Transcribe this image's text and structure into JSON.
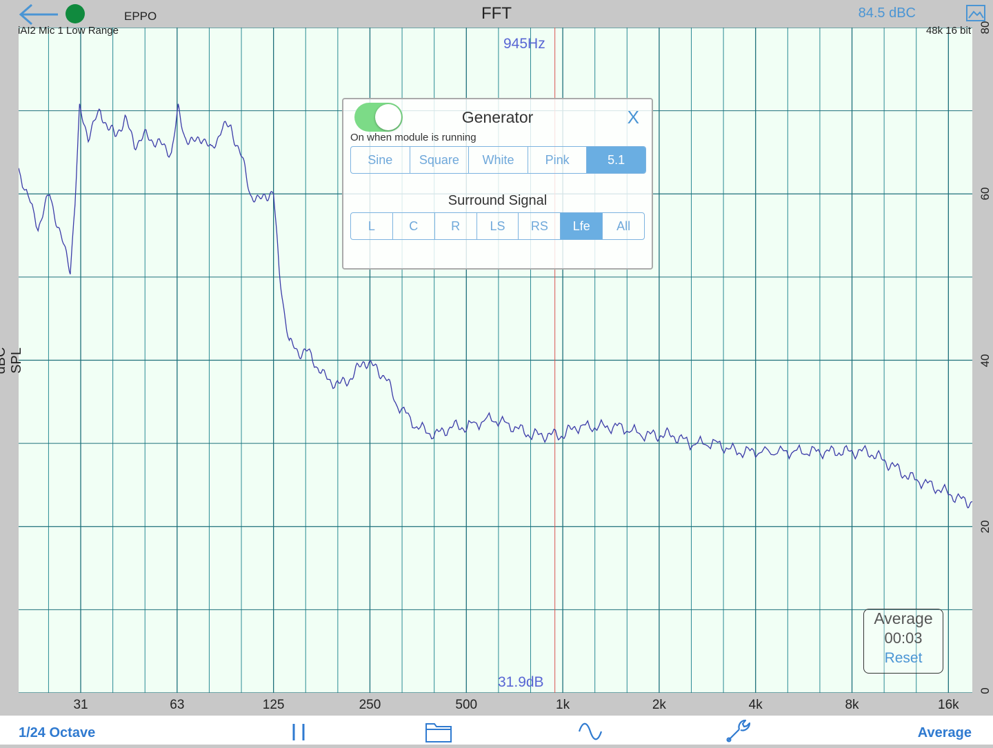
{
  "header": {
    "title": "FFT",
    "device": "EPPO",
    "level": "84.5 dBC",
    "input": "iAI2 Mic 1 Low Range",
    "format": "48k 16 bit"
  },
  "cursor": {
    "frequency": "945Hz",
    "level": "31.9dB"
  },
  "average_box": {
    "title": "Average",
    "time": "00:03",
    "reset": "Reset"
  },
  "generator": {
    "title": "Generator",
    "close": "X",
    "hint": "On when module is running",
    "enabled": true,
    "signal_types": [
      "Sine",
      "Square",
      "White",
      "Pink",
      "5.1"
    ],
    "selected_signal": "5.1",
    "surround_title": "Surround Signal",
    "surround_channels": [
      "L",
      "C",
      "R",
      "LS",
      "RS",
      "Lfe",
      "All"
    ],
    "selected_channel": "Lfe"
  },
  "footer": {
    "resolution": "1/24 Octave",
    "mode": "Average",
    "icons": [
      "pause-icon",
      "folder-icon",
      "sine-wave-icon",
      "wrench-icon"
    ]
  },
  "colors": {
    "accent": "#4a95d4",
    "trace": "#3b3ba8",
    "cursor_line": "#d9534f",
    "grid": "#0d6a78",
    "toggle_on": "#7cdb87"
  },
  "chart_data": {
    "type": "line",
    "xlabel": "",
    "ylabel": "dBC SPL",
    "x_scale": "log",
    "x_ticks": [
      "31",
      "63",
      "125",
      "250",
      "500",
      "1k",
      "2k",
      "4k",
      "8k",
      "16k"
    ],
    "y_ticks": [
      "0",
      "20",
      "40",
      "60",
      "80"
    ],
    "ylim": [
      0,
      80
    ],
    "xlim": [
      20,
      19000
    ],
    "cursor_frequency_hz": 945,
    "series": [
      {
        "name": "",
        "x": [
          20,
          23,
          25,
          27,
          29,
          30,
          31,
          33,
          36,
          38,
          40,
          43,
          46,
          50,
          55,
          60,
          63,
          66,
          70,
          75,
          80,
          86,
          92,
          100,
          106,
          112,
          118,
          125,
          130,
          135,
          140,
          150,
          160,
          180,
          200,
          220,
          240,
          260,
          280,
          300,
          350,
          400,
          450,
          500,
          600,
          700,
          800,
          900,
          1000,
          1100,
          1300,
          1500,
          1800,
          2000,
          2200,
          2500,
          3000,
          3500,
          4000,
          5000,
          6000,
          7000,
          8000,
          9000,
          10000,
          11000,
          12000,
          14000,
          16000,
          18000,
          19000
        ],
        "y": [
          63,
          56,
          60,
          55,
          51,
          59,
          70,
          67,
          70,
          68,
          67,
          69,
          66,
          67,
          66,
          65,
          70,
          67,
          66,
          67,
          65,
          68,
          68,
          64,
          60,
          59,
          60,
          60,
          51,
          46,
          42,
          41,
          41,
          38,
          37,
          38,
          40,
          39,
          38,
          35,
          32,
          31,
          32,
          32,
          33,
          32,
          31,
          31,
          31,
          32,
          32,
          32,
          31,
          31,
          31,
          30,
          30,
          29,
          29,
          29,
          29,
          29,
          29,
          29,
          28,
          27,
          26,
          25,
          24,
          23,
          23
        ]
      }
    ]
  }
}
